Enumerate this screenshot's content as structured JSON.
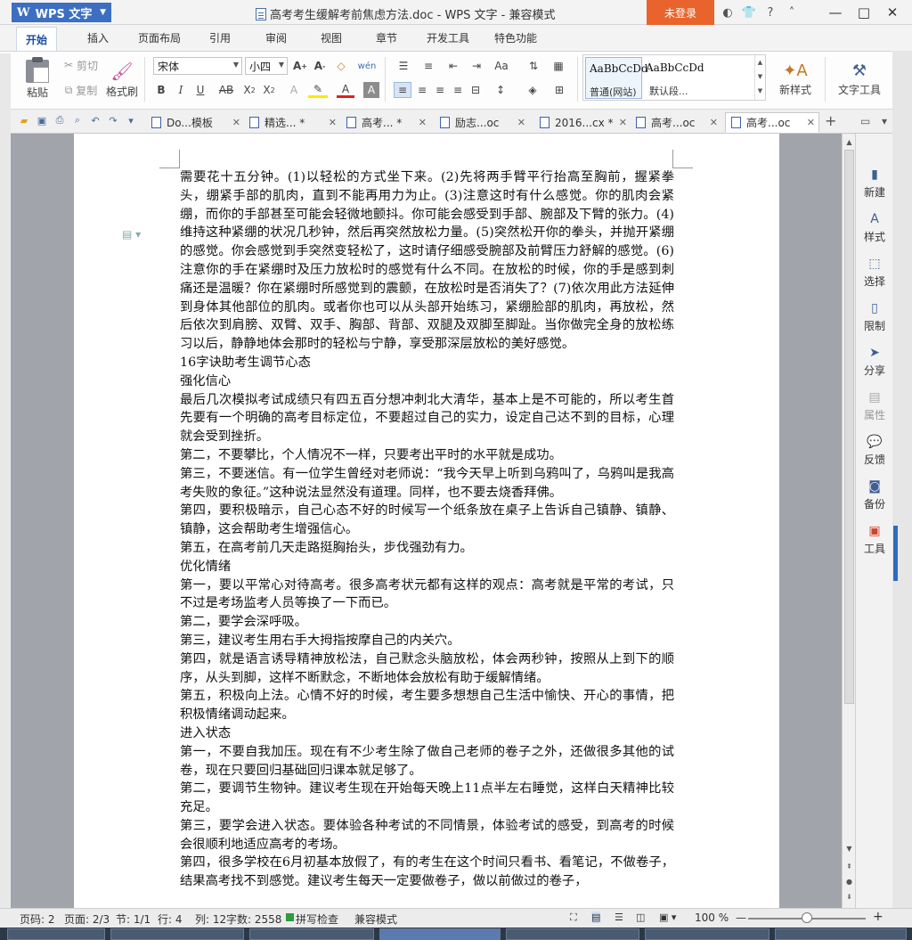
{
  "app": {
    "badge": "WPS 文字",
    "logo": "W",
    "window_title": "高考考生缓解考前焦虑方法.doc - WPS 文字 - 兼容模式",
    "login": "未登录"
  },
  "title_icons": [
    "◐",
    "👕",
    "?",
    "˄"
  ],
  "ribbon_tabs": [
    "开始",
    "插入",
    "页面布局",
    "引用",
    "审阅",
    "视图",
    "章节",
    "开发工具",
    "特色功能"
  ],
  "ribbon": {
    "paste": "粘贴",
    "cut": "剪切",
    "copy": "复制",
    "format_painter": "格式刷",
    "font_name": "宋体",
    "font_size": "小四",
    "style1_sample": "AaBbCcDd",
    "style1_name": "普通(网站)",
    "style2_sample": "AaBbCcDd",
    "style2_name": "默认段...",
    "new_style": "新样式",
    "text_tools": "文字工具"
  },
  "doc_tabs": [
    {
      "label": "Do...模板"
    },
    {
      "label": "精选... *"
    },
    {
      "label": "高考... *"
    },
    {
      "label": "励志...oc"
    },
    {
      "label": "2016...cx *"
    },
    {
      "label": "高考...oc"
    },
    {
      "label": "高考...oc"
    }
  ],
  "document": {
    "paragraphs": [
      "需要花十五分钟。(1)以轻松的方式坐下来。(2)先将两手臂平行抬高至胸前，握紧拳头，绷紧手部的肌肉，直到不能再用力为止。(3)注意这时有什么感觉。你的肌肉会紧绷，而你的手部甚至可能会轻微地颤抖。你可能会感受到手部、腕部及下臂的张力。(4)维持这种紧绷的状况几秒钟，然后再突然放松力量。(5)突然松开你的拳头，并抛开紧绷的感觉。你会感觉到手突然变轻松了，这时请仔细感受腕部及前臂压力舒解的感觉。(6)注意你的手在紧绷时及压力放松时的感觉有什么不同。在放松的时候，你的手是感到刺痛还是温暖？你在紧绷时所感觉到的震颤，在放松时是否消失了？(7)依次用此方法延伸到身体其他部位的肌肉。或者你也可以从头部开始练习，紧绷脸部的肌肉，再放松，然后依次到肩膀、双臂、双手、胸部、背部、双腿及双脚至脚趾。当你做完全身的放松练习以后，静静地体会那时的轻松与宁静，享受那深层放松的美好感觉。",
      "16字诀助考生调节心态",
      "强化信心",
      "最后几次模拟考试成绩只有四五百分想冲刺北大清华，基本上是不可能的，所以考生首先要有一个明确的高考目标定位，不要超过自己的实力，设定自己达不到的目标，心理就会受到挫折。",
      "第二，不要攀比，个人情况不一样，只要考出平时的水平就是成功。",
      "第三，不要迷信。有一位学生曾经对老师说：“我今天早上听到乌鸦叫了，乌鸦叫是我高考失败的象征。”这种说法显然没有道理。同样，也不要去烧香拜佛。",
      "第四，要积极暗示，自己心态不好的时候写一个纸条放在桌子上告诉自己镇静、镇静、镇静，这会帮助考生增强信心。",
      "第五，在高考前几天走路挺胸抬头，步伐强劲有力。",
      "优化情绪",
      "第一，要以平常心对待高考。很多高考状元都有这样的观点：高考就是平常的考试，只不过是考场监考人员等换了一下而已。",
      "第二，要学会深呼吸。",
      "第三，建议考生用右手大拇指按摩自己的内关穴。",
      "第四，就是语言诱导精神放松法，自己默念头脑放松，体会两秒钟，按照从上到下的顺序，从头到脚，这样不断默念，不断地体会放松有助于缓解情绪。",
      "第五，积极向上法。心情不好的时候，考生要多想想自己生活中愉快、开心的事情，把积极情绪调动起来。",
      "进入状态",
      "第一，不要自我加压。现在有不少考生除了做自己老师的卷子之外，还做很多其他的试卷，现在只要回归基础回归课本就足够了。",
      "第二，要调节生物钟。建议考生现在开始每天晚上11点半左右睡觉，这样白天精神比较充足。",
      "第三，要学会进入状态。要体验各种考试的不同情景，体验考试的感受，到高考的时候会很顺利地适应高考的考场。",
      "第四，很多学校在6月初基本放假了，有的考生在这个时间只看书、看笔记，不做卷子，结果高考找不到感觉。建议考生每天一定要做卷子，做以前做过的卷子，"
    ]
  },
  "right_pane": [
    "新建",
    "样式",
    "选择",
    "限制",
    "分享",
    "属性",
    "反馈",
    "备份",
    "工具"
  ],
  "status": {
    "page_no": "页码: 2",
    "pages": "页面: 2/3",
    "section": "节: 1/1",
    "row": "行: 4",
    "col": "列: 12",
    "words": "字数: 2558",
    "spell": "拼写检查",
    "mode": "兼容模式",
    "zoom": "100 %"
  }
}
